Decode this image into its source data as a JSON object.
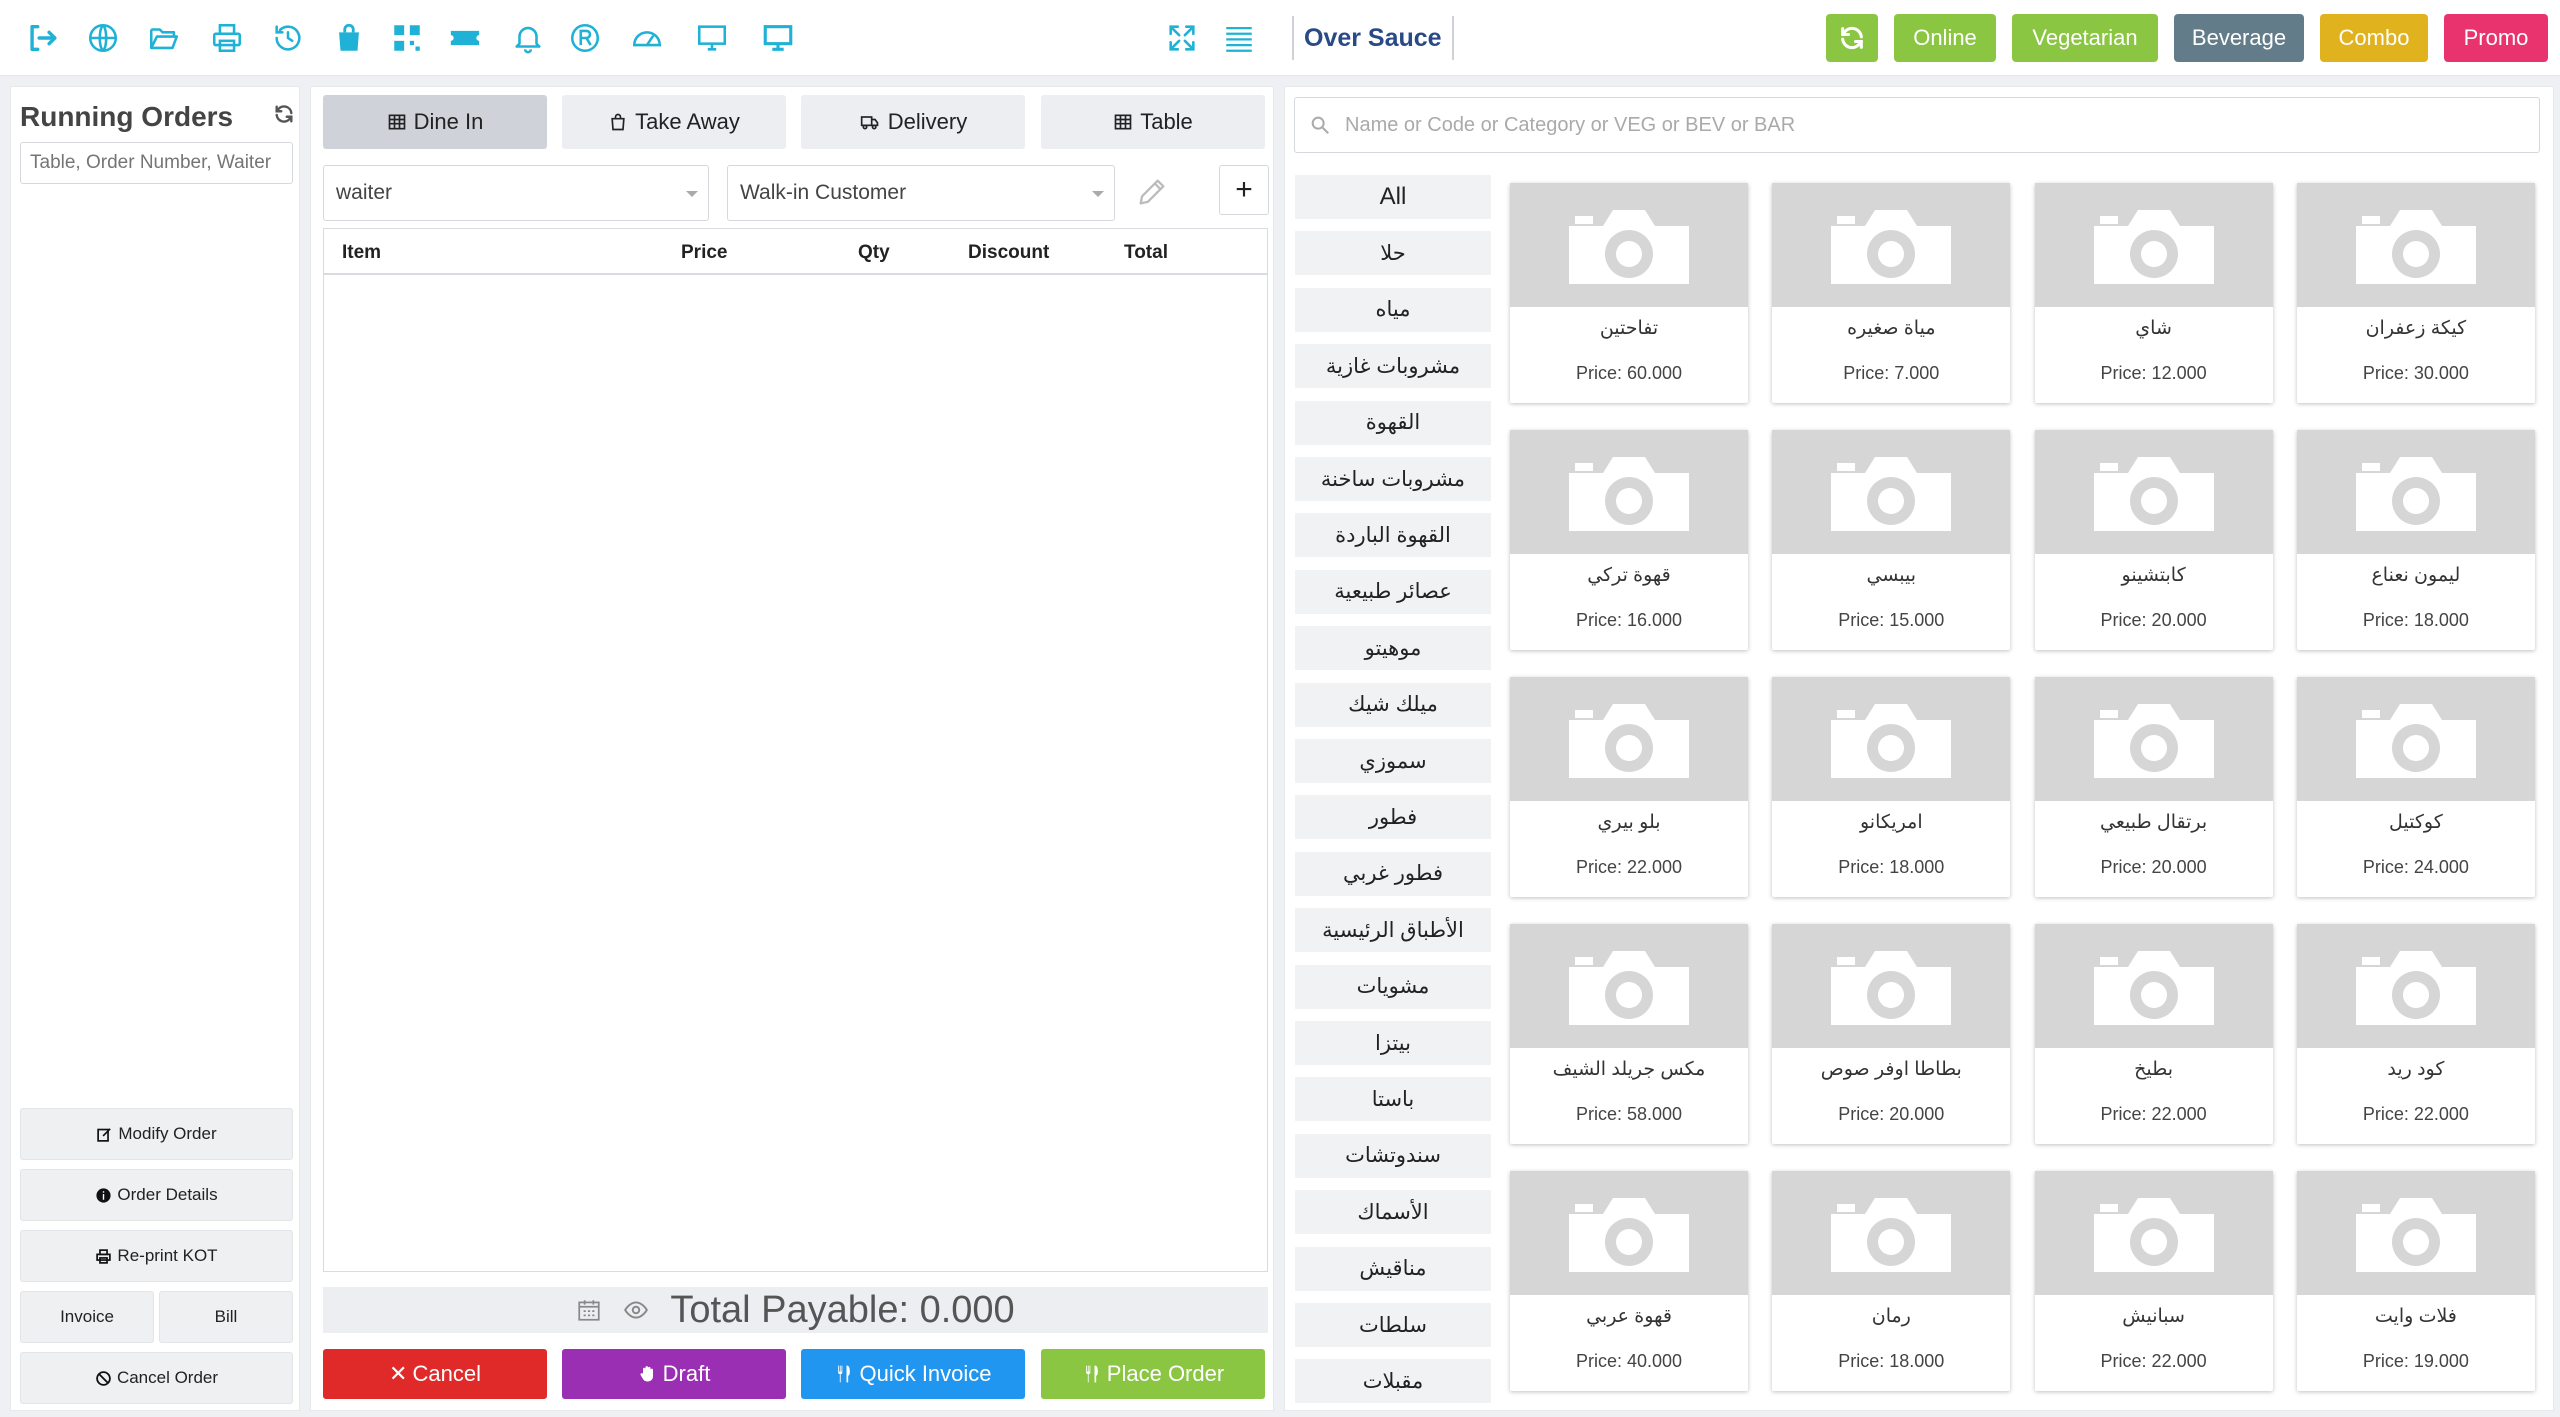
{
  "header": {
    "brand": "Over Sauce",
    "filters": [
      {
        "label": "Online",
        "color": "#8ac641"
      },
      {
        "label": "Vegetarian",
        "color": "#8ac641"
      },
      {
        "label": "Beverage",
        "color": "#637c8a"
      },
      {
        "label": "Combo",
        "color": "#e0b21e"
      },
      {
        "label": "Promo",
        "color": "#e8336e"
      }
    ],
    "refresh_color": "#8ac641"
  },
  "running_orders": {
    "title": "Running Orders",
    "search_placeholder": "Table, Order Number, Waiter",
    "buttons": {
      "modify": "Modify Order",
      "details": "Order Details",
      "reprint": "Re-print KOT",
      "invoice": "Invoice",
      "bill": "Bill",
      "cancel": "Cancel Order"
    }
  },
  "order": {
    "tabs": [
      "Dine In",
      "Take Away",
      "Delivery",
      "Table"
    ],
    "waiter": "waiter",
    "customer": "Walk-in Customer",
    "columns": [
      "Item",
      "Price",
      "Qty",
      "Discount",
      "Total"
    ],
    "total_payable": "Total Payable: 0.000",
    "actions": [
      {
        "label": "Cancel",
        "color": "#e02a2a"
      },
      {
        "label": "Draft",
        "color": "#9a2fb3"
      },
      {
        "label": "Quick Invoice",
        "color": "#2196f0"
      },
      {
        "label": "Place Order",
        "color": "#8ac641"
      }
    ]
  },
  "menu": {
    "search_placeholder": "Name or Code or Category or VEG or BEV or BAR",
    "categories": [
      "All",
      "حلا",
      "مياه",
      "مشروبات غازية",
      "القهوة",
      "مشروبات ساخنة",
      "القهوة الباردة",
      "عصائر طبيعية",
      "موهيتو",
      "ميلك شيك",
      "سموزي",
      "فطور",
      "فطور غربي",
      "الأطباق الرئيسية",
      "مشويات",
      "بيتزا",
      "باستا",
      "سندوتشات",
      "الأسماك",
      "مناقيش",
      "سلطات",
      "مقبلات"
    ],
    "products": [
      {
        "name": "تفاحتين",
        "price": "Price: 60.000"
      },
      {
        "name": "مياة صغيره",
        "price": "Price: 7.000"
      },
      {
        "name": "شاي",
        "price": "Price: 12.000"
      },
      {
        "name": "كيكة زعفران",
        "price": "Price: 30.000"
      },
      {
        "name": "قهوة تركي",
        "price": "Price: 16.000"
      },
      {
        "name": "بيبسي",
        "price": "Price: 15.000"
      },
      {
        "name": "كابتشينو",
        "price": "Price: 20.000"
      },
      {
        "name": "ليمون نعناع",
        "price": "Price: 18.000"
      },
      {
        "name": "بلو بيري",
        "price": "Price: 22.000"
      },
      {
        "name": "امريكانو",
        "price": "Price: 18.000"
      },
      {
        "name": "برتقال طبيعي",
        "price": "Price: 20.000"
      },
      {
        "name": "كوكتيل",
        "price": "Price: 24.000"
      },
      {
        "name": "مكس جريلد الشيف",
        "price": "Price: 58.000"
      },
      {
        "name": "بطاطا اوفر صوص",
        "price": "Price: 20.000"
      },
      {
        "name": "بطيخ",
        "price": "Price: 22.000"
      },
      {
        "name": "كود ريد",
        "price": "Price: 22.000"
      },
      {
        "name": "قهوة عربي",
        "price": "Price: 40.000"
      },
      {
        "name": "رمان",
        "price": "Price: 18.000"
      },
      {
        "name": "سبانيش",
        "price": "Price: 22.000"
      },
      {
        "name": "فلات وايت",
        "price": "Price: 19.000"
      }
    ]
  }
}
